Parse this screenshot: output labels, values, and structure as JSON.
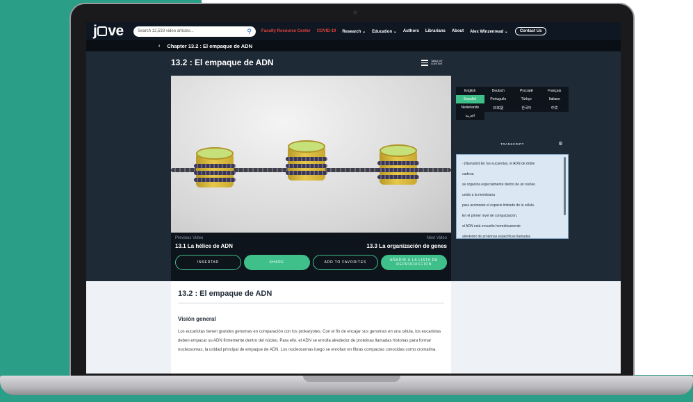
{
  "header": {
    "logo": "jove",
    "search_placeholder": "Search 12,533 video articles...",
    "links": [
      "Faculty Resource Center",
      "COVID-19",
      "Research ⌄",
      "Education ⌄",
      "Authors",
      "Librarians",
      "About",
      "Alex Winzenread ⌄"
    ],
    "contact_label": "Contact Us"
  },
  "chapter_bar": {
    "back_icon": "‹",
    "label": "Chapter 13.2 : El empaque de ADN"
  },
  "page": {
    "title": "13.2 : El empaque de ADN",
    "toc_label": "TABLE OF CONTENT"
  },
  "video_nav": {
    "prev_label": "Previous Video",
    "prev_title": "13.1 La hélice de ADN",
    "next_label": "Next Video",
    "next_title": "13.3 La organización de genes",
    "buttons": [
      "INSERTAR",
      "SHARE",
      "ADD TO FAVORITES",
      "AÑADIR A LA LISTA DE REPRODUCCIÓN"
    ]
  },
  "languages": [
    [
      "English",
      "Deutsch",
      "Русский",
      "Français"
    ],
    [
      "Español",
      "Português",
      "Türkçe",
      "Italiano"
    ],
    [
      "Nederlands",
      "日本語",
      "한국어",
      "中文"
    ],
    [
      "العربية"
    ]
  ],
  "active_language": "Español",
  "transcript": {
    "label": "TRANSCRIPT",
    "lines": [
      "- [Narrador] En los eucariotas, el ADN de doble",
      "cadena",
      "se organiza especialmente dentro de un núcleo",
      "unido a la membrana",
      "para acomodar el espacio limitado de la célula.",
      "En el primer nivel de compactación,",
      "el ADN está envuelto herméticamente",
      "alrededor de proteínas específicas llamadas"
    ]
  },
  "article": {
    "title": "13.2 : El empaque de ADN",
    "section": "Visión general",
    "body": "Los eucariotas tienen grandes genomas en comparación con los prokaryotes. Con el fin de encajar sus genomas en una célula, los eucariotas deben empacar su ADN firmemente dentro del núcleo. Para ello, el ADN se enrolla alrededor de proteínas llamadas histonas para formar nucleosomas, la unidad principal de empaque de ADN. Los nucleosomas luego se enrollan en fibras compactas conocidas como cromatina."
  },
  "colors": {
    "accent": "#3fc08a",
    "nav_bg": "#0f1722",
    "page_bg": "#1f2a37",
    "backdrop": "#2a9e86"
  }
}
